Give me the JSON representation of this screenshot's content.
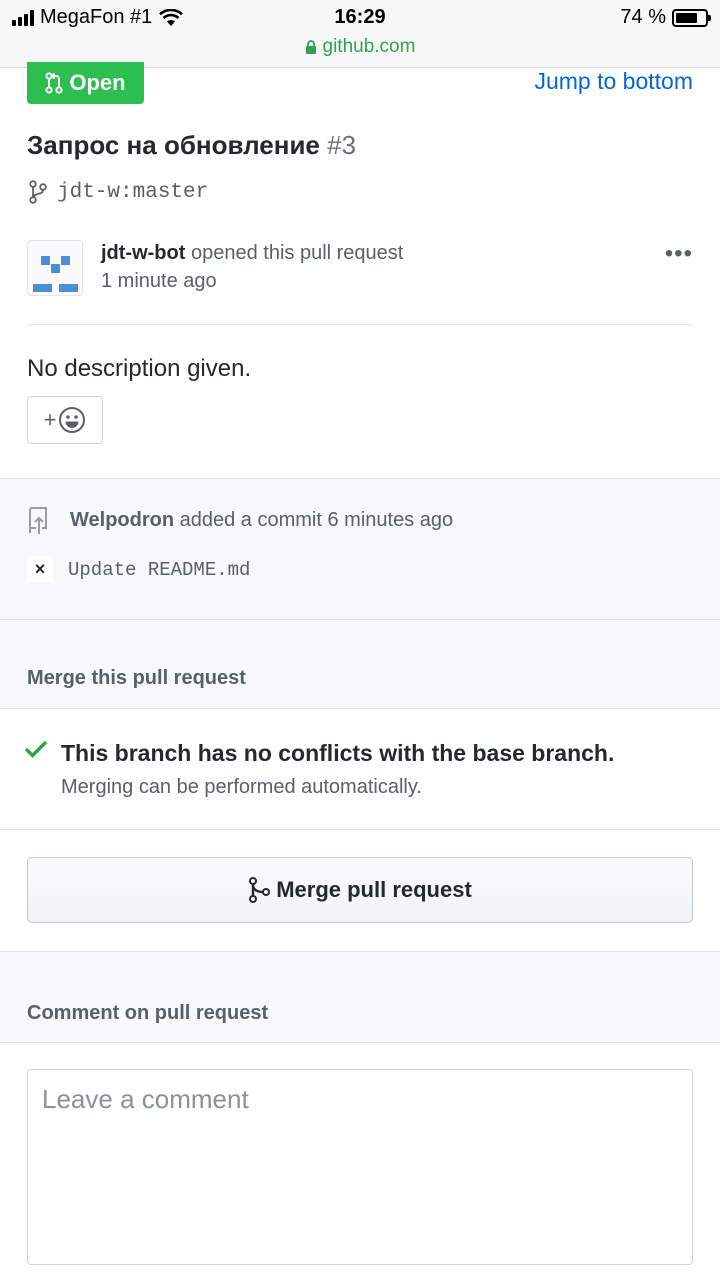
{
  "status_bar": {
    "carrier": "MegaFon #1",
    "time": "16:29",
    "battery": "74 %",
    "url": "github.com"
  },
  "header": {
    "state_badge": "Open",
    "jump_link": "Jump to bottom"
  },
  "pr": {
    "title": "Запрос на обновление",
    "number": "#3",
    "branch": "jdt-w:master",
    "author": "jdt-w-bot",
    "action": "opened this pull request",
    "time": "1 minute ago",
    "description": "No description given.",
    "reaction_plus": "+"
  },
  "timeline": {
    "commit_author": "Welpodron",
    "commit_action": "added a commit 6 minutes ago",
    "commit_status": "×",
    "commit_message": "Update README.md"
  },
  "merge": {
    "section_heading": "Merge this pull request",
    "status": "This branch has no conflicts with the base branch.",
    "status_sub": "Merging can be performed automatically.",
    "button_label": "Merge pull request"
  },
  "comment": {
    "section_heading": "Comment on pull request",
    "placeholder": "Leave a comment",
    "value": ""
  },
  "colors": {
    "open_green": "#2cbe4e",
    "link_blue": "#0366d6",
    "check_green": "#28a745"
  }
}
